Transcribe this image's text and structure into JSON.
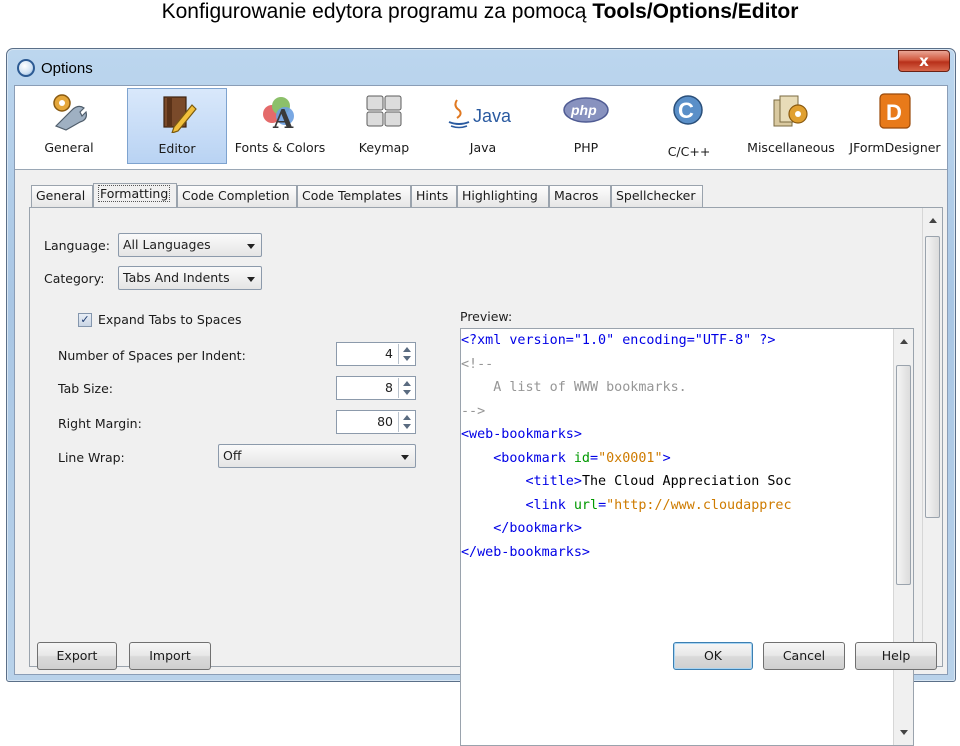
{
  "caption": {
    "prefix": "Konfigurowanie edytora programu za pomocą ",
    "bold": "Tools/Options/Editor"
  },
  "window": {
    "title": "Options",
    "close_label": "x"
  },
  "categories": [
    {
      "label": "General",
      "icon": "general-tools-icon",
      "selected": false
    },
    {
      "label": "Editor",
      "icon": "editor-pencil-book-icon",
      "selected": true
    },
    {
      "label": "Fonts & Colors",
      "icon": "fonts-colors-icon",
      "selected": false
    },
    {
      "label": "Keymap",
      "icon": "keymap-keyboard-icon",
      "selected": false
    },
    {
      "label": "Java",
      "icon": "java-logo-icon",
      "selected": false
    },
    {
      "label": "PHP",
      "icon": "php-logo-icon",
      "selected": false
    },
    {
      "label": "C/C++",
      "icon": "cpp-logo-icon",
      "selected": false
    },
    {
      "label": "Miscellaneous",
      "icon": "miscellaneous-icon",
      "selected": false
    },
    {
      "label": "JFormDesigner",
      "icon": "jformdesigner-icon",
      "selected": false
    }
  ],
  "java_logo_text": "Java",
  "php_logo_text": "php",
  "tabs": [
    "General",
    "Formatting",
    "Code Completion",
    "Code Templates",
    "Hints",
    "Highlighting",
    "Macros",
    "Spellchecker"
  ],
  "active_tab": "Formatting",
  "form": {
    "language_label": "Language:",
    "language_value": "All Languages",
    "category_label": "Category:",
    "category_value": "Tabs And Indents",
    "expand_tabs_label": "Expand Tabs to Spaces",
    "expand_tabs_checked": true,
    "spaces_per_indent_label": "Number of Spaces per Indent:",
    "spaces_per_indent_value": "4",
    "tab_size_label": "Tab Size:",
    "tab_size_value": "8",
    "right_margin_label": "Right Margin:",
    "right_margin_value": "80",
    "line_wrap_label": "Line Wrap:",
    "line_wrap_value": "Off"
  },
  "preview": {
    "label": "Preview:",
    "lines": [
      {
        "indent": "",
        "parts": [
          [
            "tag",
            "<?xml version=\"1.0\" encoding=\"UTF-8\" ?>"
          ]
        ]
      },
      {
        "indent": "",
        "parts": [
          [
            "cmt",
            "<!--"
          ]
        ]
      },
      {
        "indent": "    ",
        "parts": [
          [
            "cmt",
            "A list of WWW bookmarks."
          ]
        ]
      },
      {
        "indent": "",
        "parts": [
          [
            "cmt",
            "-->"
          ]
        ]
      },
      {
        "indent": "",
        "parts": [
          [
            "tag",
            "<web-bookmarks>"
          ]
        ]
      },
      {
        "indent": "    ",
        "parts": [
          [
            "tag",
            "<bookmark "
          ],
          [
            "attr",
            "id"
          ],
          [
            "tag",
            "="
          ],
          [
            "str",
            "\"0x0001\""
          ],
          [
            "tag",
            ">"
          ]
        ]
      },
      {
        "indent": "        ",
        "parts": [
          [
            "tag",
            "<title>"
          ],
          [
            "",
            "The Cloud Appreciation Soc"
          ]
        ]
      },
      {
        "indent": "        ",
        "parts": [
          [
            "tag",
            "<link "
          ],
          [
            "attr",
            "url"
          ],
          [
            "tag",
            "="
          ],
          [
            "str",
            "\"http://www.cloudapprec"
          ]
        ]
      },
      {
        "indent": "    ",
        "parts": [
          [
            "tag",
            "</bookmark>"
          ]
        ]
      },
      {
        "indent": "",
        "parts": [
          [
            "tag",
            "</web-bookmarks>"
          ]
        ]
      }
    ]
  },
  "buttons": {
    "export": "Export",
    "import": "Import",
    "ok": "OK",
    "cancel": "Cancel",
    "help": "Help"
  }
}
